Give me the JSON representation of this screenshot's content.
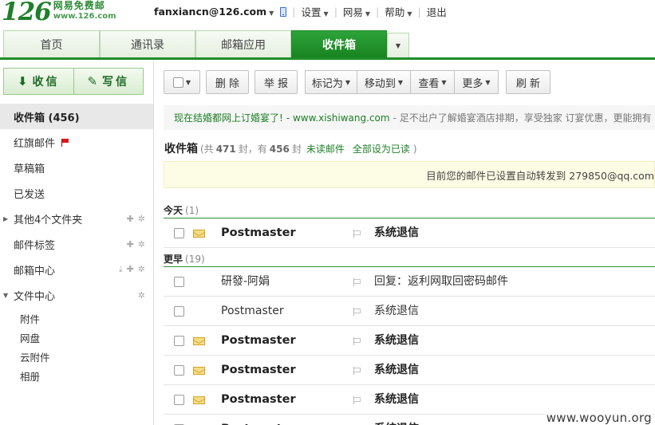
{
  "logo": {
    "number": "126",
    "name": "网易免费邮",
    "url": "www.126.com"
  },
  "topnav": {
    "account": "fanxiancn@126.com",
    "settings": "设置",
    "netease": "网易",
    "help": "帮助",
    "logout": "退出"
  },
  "tabs": [
    {
      "label": "首页",
      "active": false
    },
    {
      "label": "通讯录",
      "active": false
    },
    {
      "label": "邮箱应用",
      "active": false
    },
    {
      "label": "收件箱",
      "active": true
    }
  ],
  "sidebar": {
    "receive_label": "收信",
    "compose_label": "写信",
    "folders": [
      {
        "label": "收件箱 (456)",
        "active": true
      },
      {
        "label": "红旗邮件"
      },
      {
        "label": "草稿箱"
      },
      {
        "label": "已发送"
      },
      {
        "label": "其他4个文件夹"
      },
      {
        "label": "邮件标签"
      },
      {
        "label": "邮箱中心"
      },
      {
        "label": "文件中心"
      }
    ],
    "file_center_items": [
      "附件",
      "网盘",
      "云附件",
      "相册"
    ]
  },
  "toolbar": {
    "delete": "删 除",
    "report": "举 报",
    "mark_as": "标记为",
    "move_to": "移动到",
    "view": "查看",
    "more": "更多",
    "refresh": "刷 新"
  },
  "ad": {
    "headline": "现在结婚都网上订婚宴了!",
    "link": "- www.xishiwang.com",
    "desc": "- 足不出户了解婚宴酒店排期，享受独家 订宴优惠，更能拥有"
  },
  "list_header": {
    "title": "收件箱",
    "total_prefix": "(共",
    "total": "471",
    "total_suffix": "封，有",
    "unread": "456",
    "unread_suffix": "封",
    "unread_link": "未读邮件",
    "mark_all_read": "全部设为已读",
    "close_paren": ")"
  },
  "notice": "目前您的邮件已设置自动转发到 279850@qq.com",
  "groups": [
    {
      "label": "今天",
      "count": "(1)"
    },
    {
      "label": "更早",
      "count": "(19)"
    }
  ],
  "mails": [
    {
      "sender": "Postmaster",
      "subject": "系统退信",
      "unread": true
    },
    {
      "sender": "研發-阿娟",
      "subject": "回复：返利网取回密码邮件",
      "unread": false
    },
    {
      "sender": "Postmaster",
      "subject": "系统退信",
      "unread": false
    },
    {
      "sender": "Postmaster",
      "subject": "系统退信",
      "unread": true
    },
    {
      "sender": "Postmaster",
      "subject": "系统退信",
      "unread": true
    },
    {
      "sender": "Postmaster",
      "subject": "系统退信",
      "unread": true
    },
    {
      "sender": "Postmaster",
      "subject": "系统退信",
      "unread": true
    }
  ],
  "watermark": "www.wooyun.org"
}
